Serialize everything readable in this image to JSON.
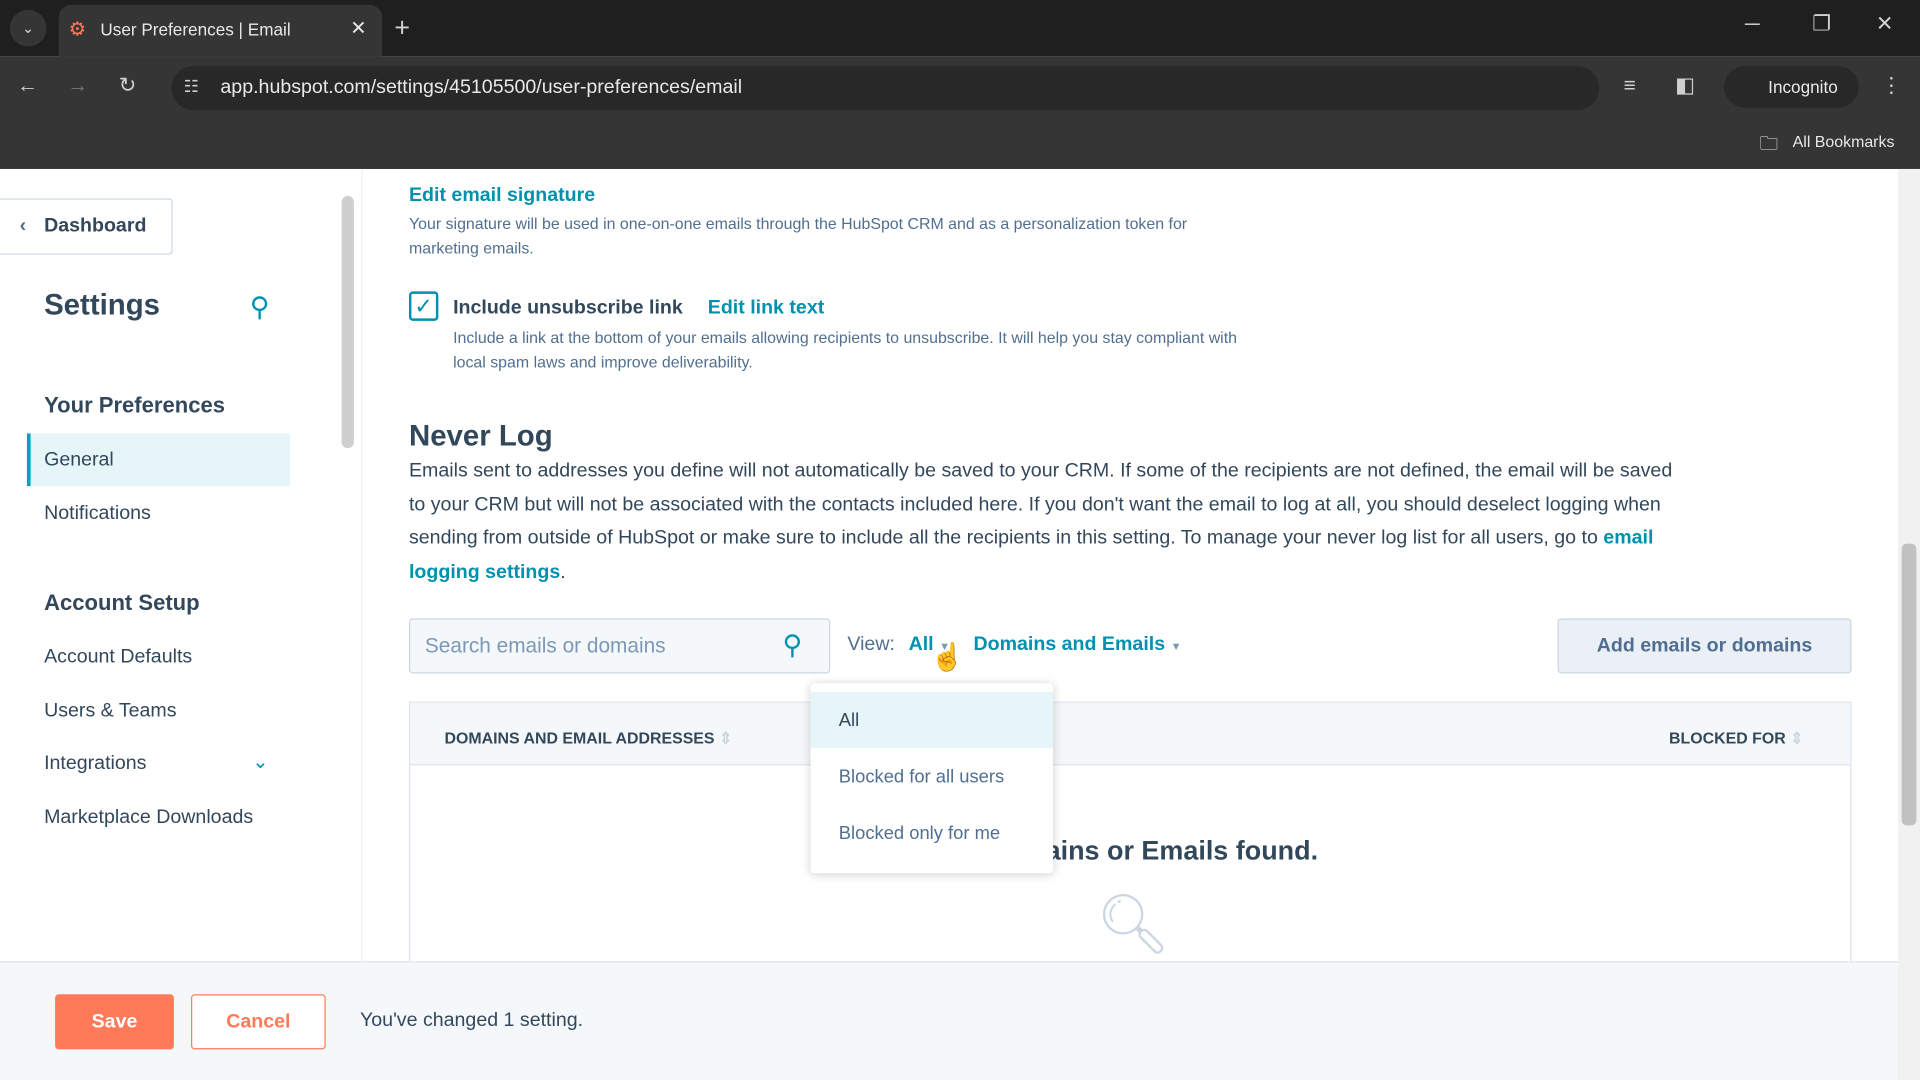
{
  "browser": {
    "tab_title": "User Preferences | Email",
    "url": "app.hubspot.com/settings/45105500/user-preferences/email",
    "profile": "Incognito",
    "bookmarks": "All Bookmarks"
  },
  "sidebar": {
    "back": "Dashboard",
    "title": "Settings",
    "sections": [
      {
        "title": "Your Preferences",
        "items": [
          "General",
          "Notifications"
        ]
      },
      {
        "title": "Account Setup",
        "items": [
          "Account Defaults",
          "Users & Teams",
          "Integrations",
          "Marketplace Downloads"
        ]
      }
    ]
  },
  "main": {
    "signature_link": "Edit email signature",
    "signature_desc": "Your signature will be used in one-on-one emails through the HubSpot CRM and as a personalization token for marketing emails.",
    "unsubscribe_label": "Include unsubscribe link",
    "unsubscribe_checked": true,
    "edit_link_text": "Edit link text",
    "unsubscribe_desc": "Include a link at the bottom of your emails allowing recipients to unsubscribe. It will help you stay compliant with local spam laws and improve deliverability.",
    "never_log_title": "Never Log",
    "never_log_desc": "Emails sent to addresses you define will not automatically be saved to your CRM. If some of the recipients are not defined, the email will be saved to your CRM but will not be associated with the contacts included here. If you don't want the email to log at all, you should deselect logging when sending from outside of HubSpot or make sure to include all the recipients in this setting. To manage your never log list for all users, go to",
    "never_log_link": "email logging settings",
    "search_placeholder": "Search emails or domains",
    "view_label": "View:",
    "view_value": "All",
    "type_value": "Domains and Emails",
    "add_button": "Add emails or domains",
    "columns": [
      "DOMAINS AND EMAIL ADDRESSES",
      "BLOCKED FOR"
    ],
    "empty_text": "No Domains or Emails found.",
    "view_options": [
      "All",
      "Blocked for all users",
      "Blocked only for me"
    ]
  },
  "footer": {
    "save": "Save",
    "cancel": "Cancel",
    "status": "You've changed 1 setting."
  },
  "colors": {
    "accent": "#0091ae",
    "save": "#ff7a59"
  }
}
